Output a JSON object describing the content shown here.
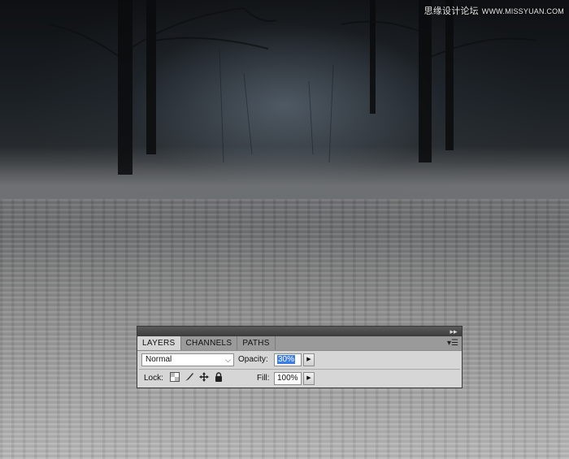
{
  "watermark": {
    "text": "思缘设计论坛",
    "site": "WWW.MISSYUAN.COM"
  },
  "layers_panel": {
    "tabs": [
      {
        "label": "LAYERS",
        "active": true
      },
      {
        "label": "CHANNELS",
        "active": false
      },
      {
        "label": "PATHS",
        "active": false
      }
    ],
    "blend_mode": "Normal",
    "opacity_label": "Opacity:",
    "opacity_value": "30%",
    "lock_label": "Lock:",
    "lock_icons": [
      "lock-transparent-pixels-icon",
      "lock-image-pixels-icon",
      "lock-position-icon",
      "lock-all-icon"
    ],
    "fill_label": "Fill:",
    "fill_value": "100%"
  },
  "colors": {
    "selection": "#3d7ee6",
    "panel_bg": "#d6d6d6",
    "tab_bar": "#9a9a9a"
  }
}
